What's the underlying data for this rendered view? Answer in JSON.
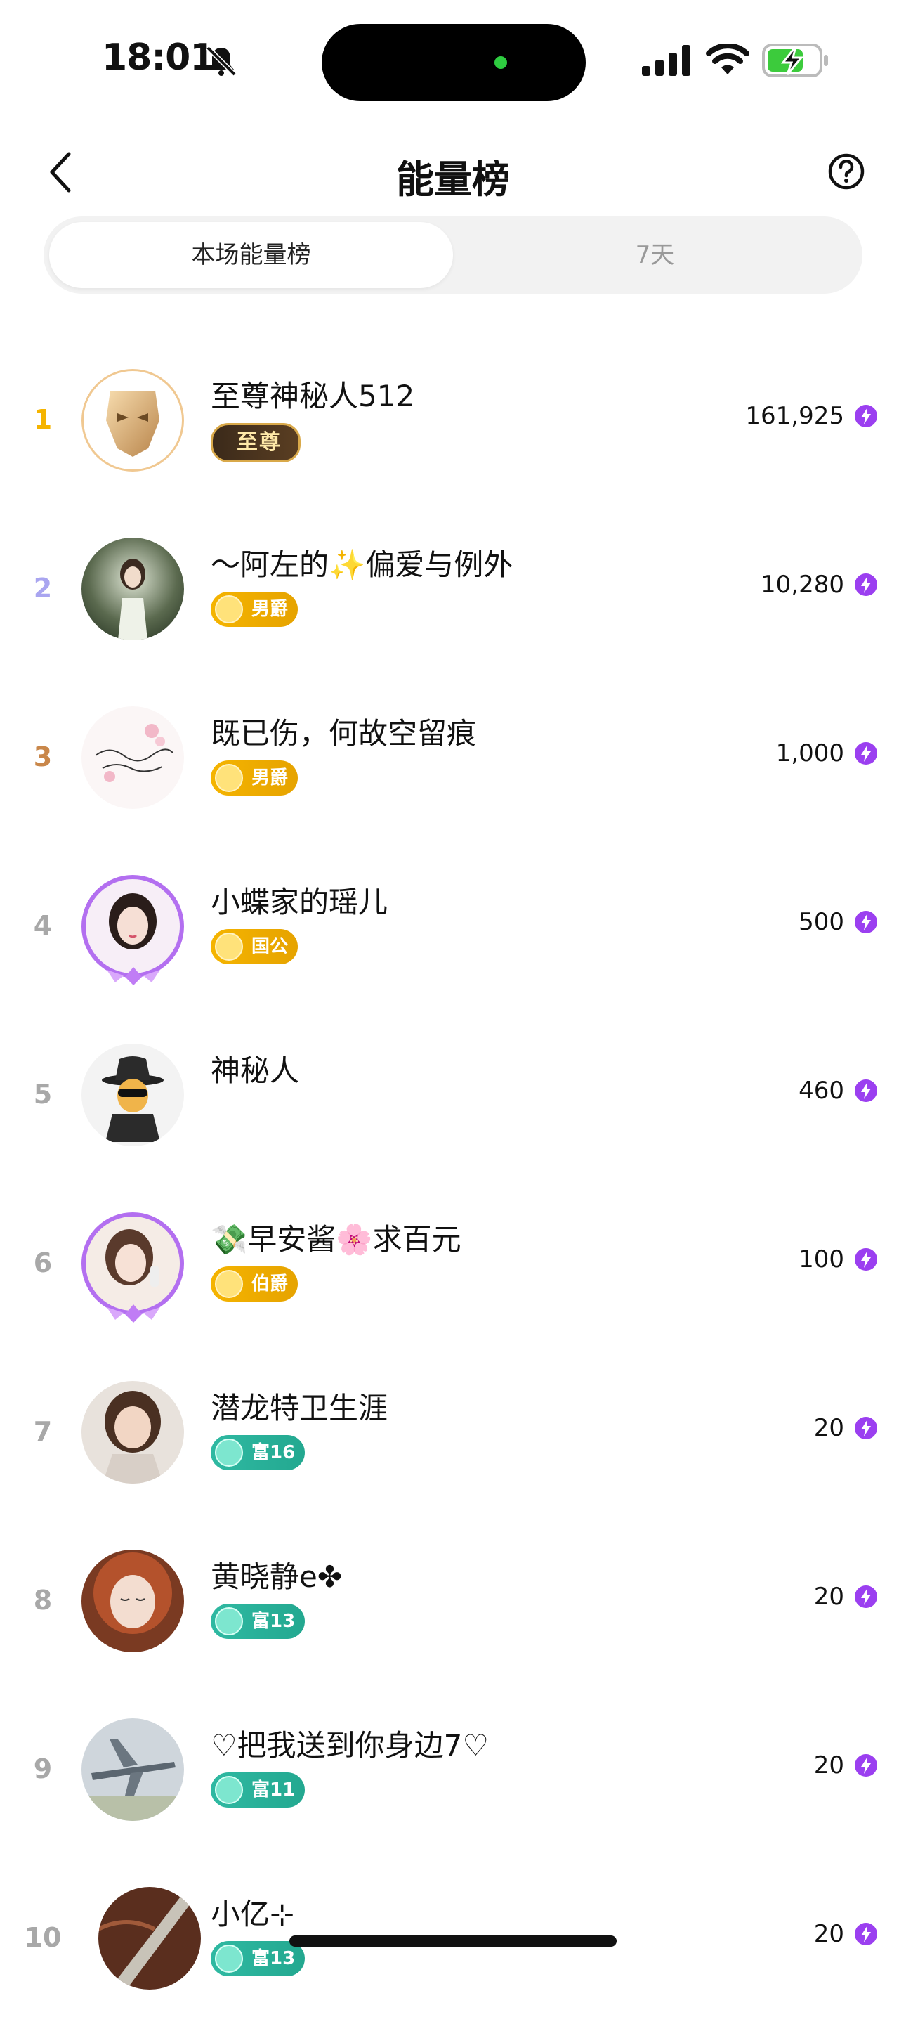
{
  "status": {
    "time": "18:01"
  },
  "nav": {
    "title": "能量榜"
  },
  "tabs": [
    {
      "label": "本场能量榜"
    },
    {
      "label": "7天"
    }
  ],
  "colors": {
    "rank1": "#f5b400",
    "rank2": "#a9a5f0",
    "rank3": "#c9874a",
    "default_rank": "#a8a8a8",
    "energy": "#9b3ff0"
  },
  "list": [
    {
      "rank": "1",
      "name": "至尊神秘人512",
      "badge": "至尊",
      "badge_style": "royal",
      "value": "161,925"
    },
    {
      "rank": "2",
      "name": "～阿左的✨偏爱与例外",
      "badge": "男爵",
      "badge_style": "gold",
      "value": "10,280"
    },
    {
      "rank": "3",
      "name": "既已伤，何故空留痕",
      "badge": "男爵",
      "badge_style": "gold",
      "value": "1,000"
    },
    {
      "rank": "4",
      "name": "小蝶家的瑶儿",
      "badge": "国公",
      "badge_style": "gold",
      "value": "500"
    },
    {
      "rank": "5",
      "name": "神秘人",
      "badge": "",
      "badge_style": "none",
      "value": "460"
    },
    {
      "rank": "6",
      "name": "💸早安酱🌸求百元",
      "badge": "伯爵",
      "badge_style": "gold",
      "value": "100"
    },
    {
      "rank": "7",
      "name": "潜龙特卫生涯",
      "badge": "富16",
      "badge_style": "teal",
      "value": "20"
    },
    {
      "rank": "8",
      "name": "黄晓静e✤",
      "badge": "富13",
      "badge_style": "teal",
      "value": "20"
    },
    {
      "rank": "9",
      "name": "♡把我送到你身边7♡",
      "badge": "富11",
      "badge_style": "teal",
      "value": "20"
    },
    {
      "rank": "10",
      "name": "小亿⊹",
      "badge": "富13",
      "badge_style": "teal",
      "value": "20"
    }
  ]
}
